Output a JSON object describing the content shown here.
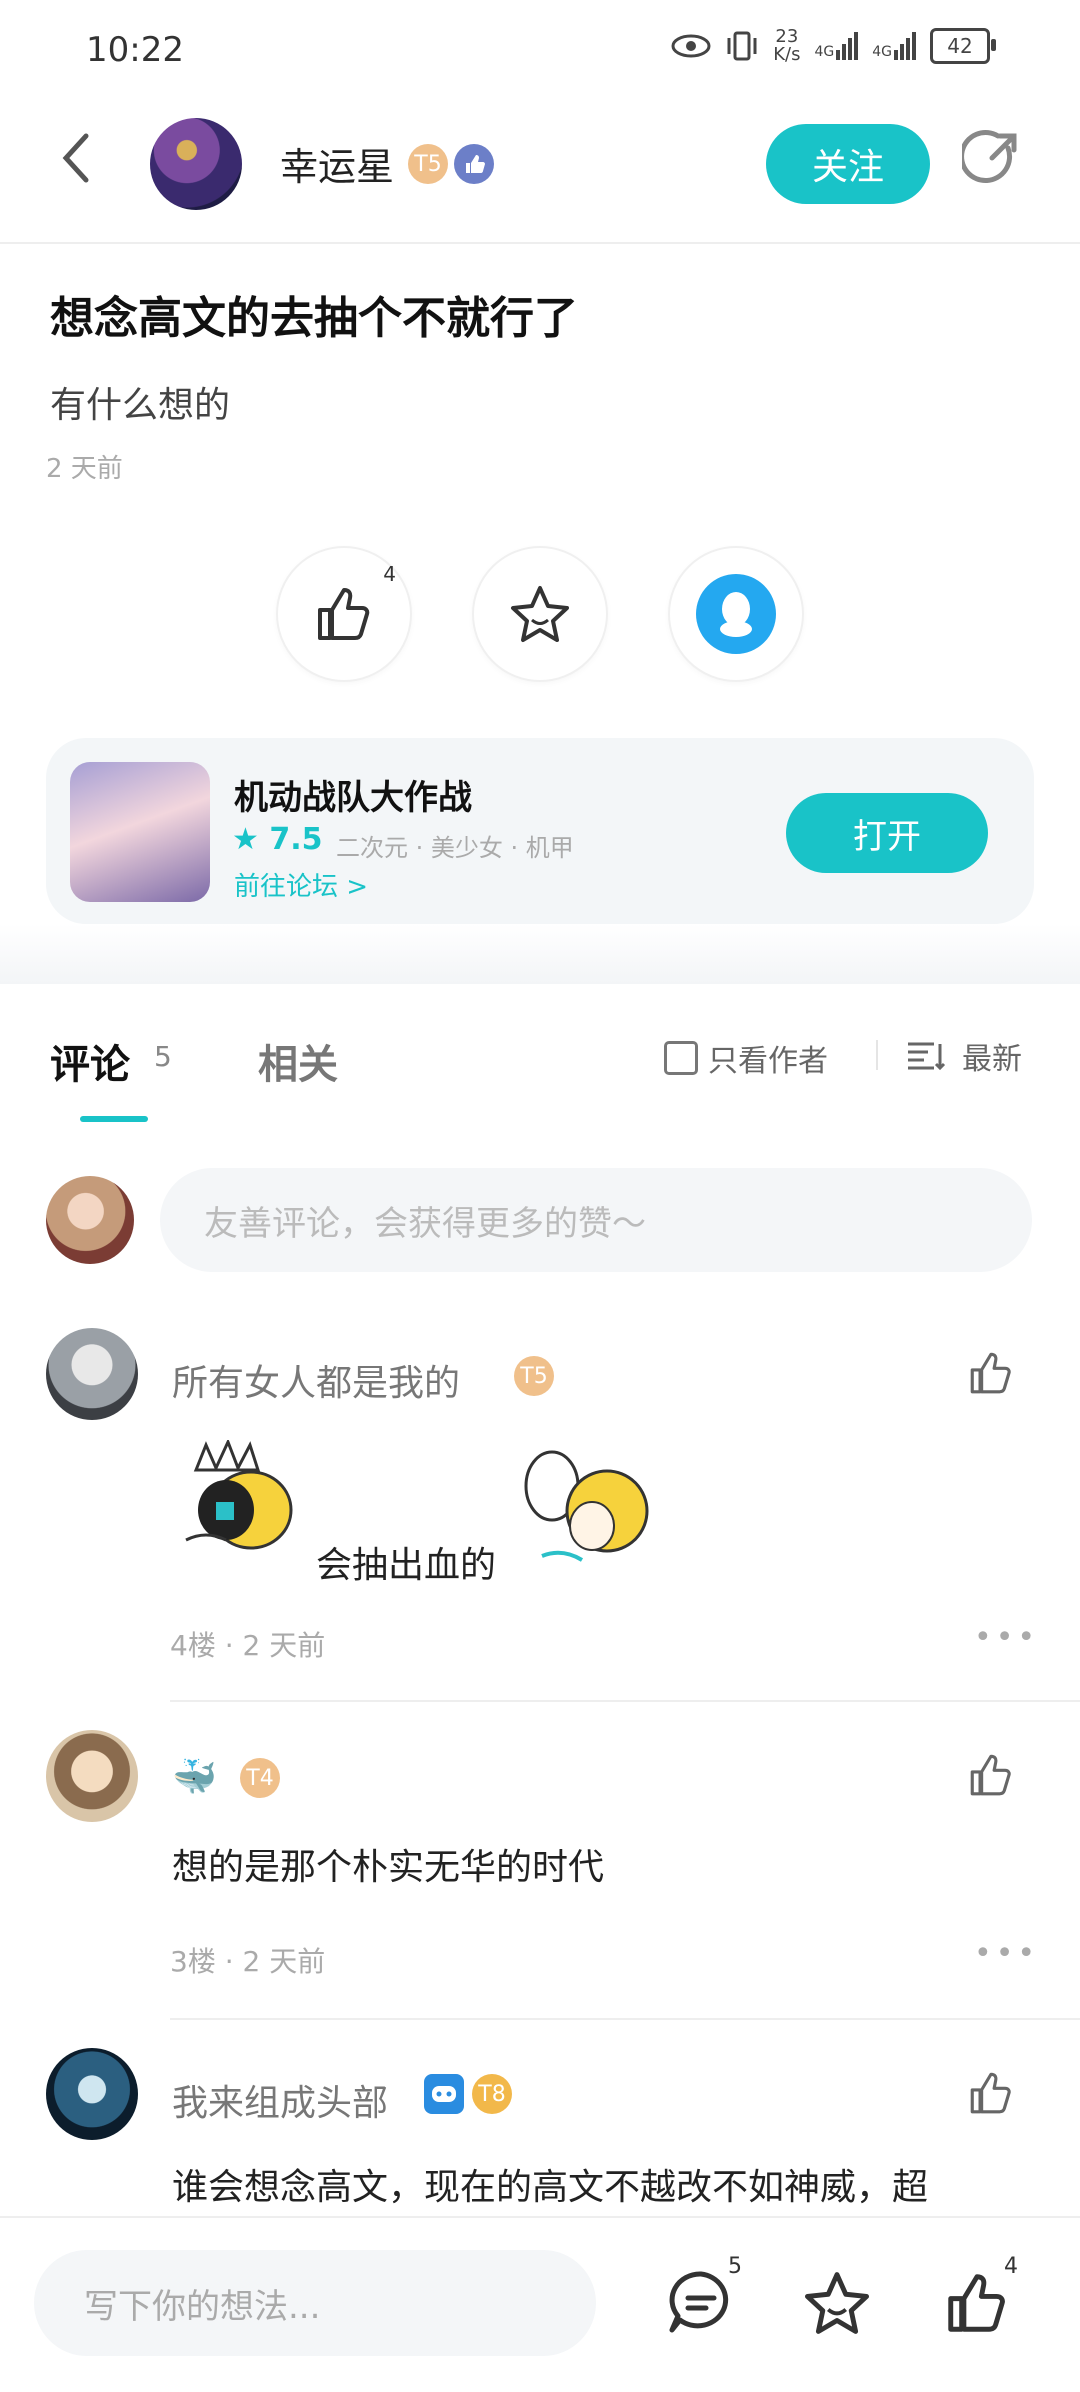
{
  "status": {
    "time": "10:22",
    "speed": "23\nK/s",
    "battery": "42",
    "net1": "4G",
    "net2": "4G"
  },
  "header": {
    "username": "幸运星",
    "level_badge": "T5",
    "follow_label": "关注"
  },
  "post": {
    "title": "想念高文的去抽个不就行了",
    "body": "有什么想的",
    "time": "2 天前",
    "like_count": "4"
  },
  "game": {
    "name": "机动战队大作战",
    "rating": "7.5",
    "tags": "二次元 · 美少女 · 机甲",
    "forum_link": "前往论坛 >",
    "open_label": "打开"
  },
  "tabs": {
    "comments_label": "评论",
    "comments_count": "5",
    "related_label": "相关",
    "author_only_label": "只看作者",
    "sort_label": "最新"
  },
  "comment_input": {
    "placeholder": "友善评论，会获得更多的赞～"
  },
  "comments": [
    {
      "name": "所有女人都是我的",
      "badge": "T5",
      "text": "会抽出血的",
      "meta": "4楼 · 2 天前"
    },
    {
      "name": "🐳",
      "badge": "T4",
      "text": "想的是那个朴实无华的时代",
      "meta": "3楼 · 2 天前"
    },
    {
      "name": "我来组成头部",
      "badge": "T8",
      "text": "谁会想念高文，现在的高文不越改不如神威，超",
      "meta": ""
    }
  ],
  "bottom": {
    "placeholder": "写下你的想法...",
    "comment_count": "5",
    "like_count": "4"
  },
  "colors": {
    "accent": "#19c3c8"
  }
}
